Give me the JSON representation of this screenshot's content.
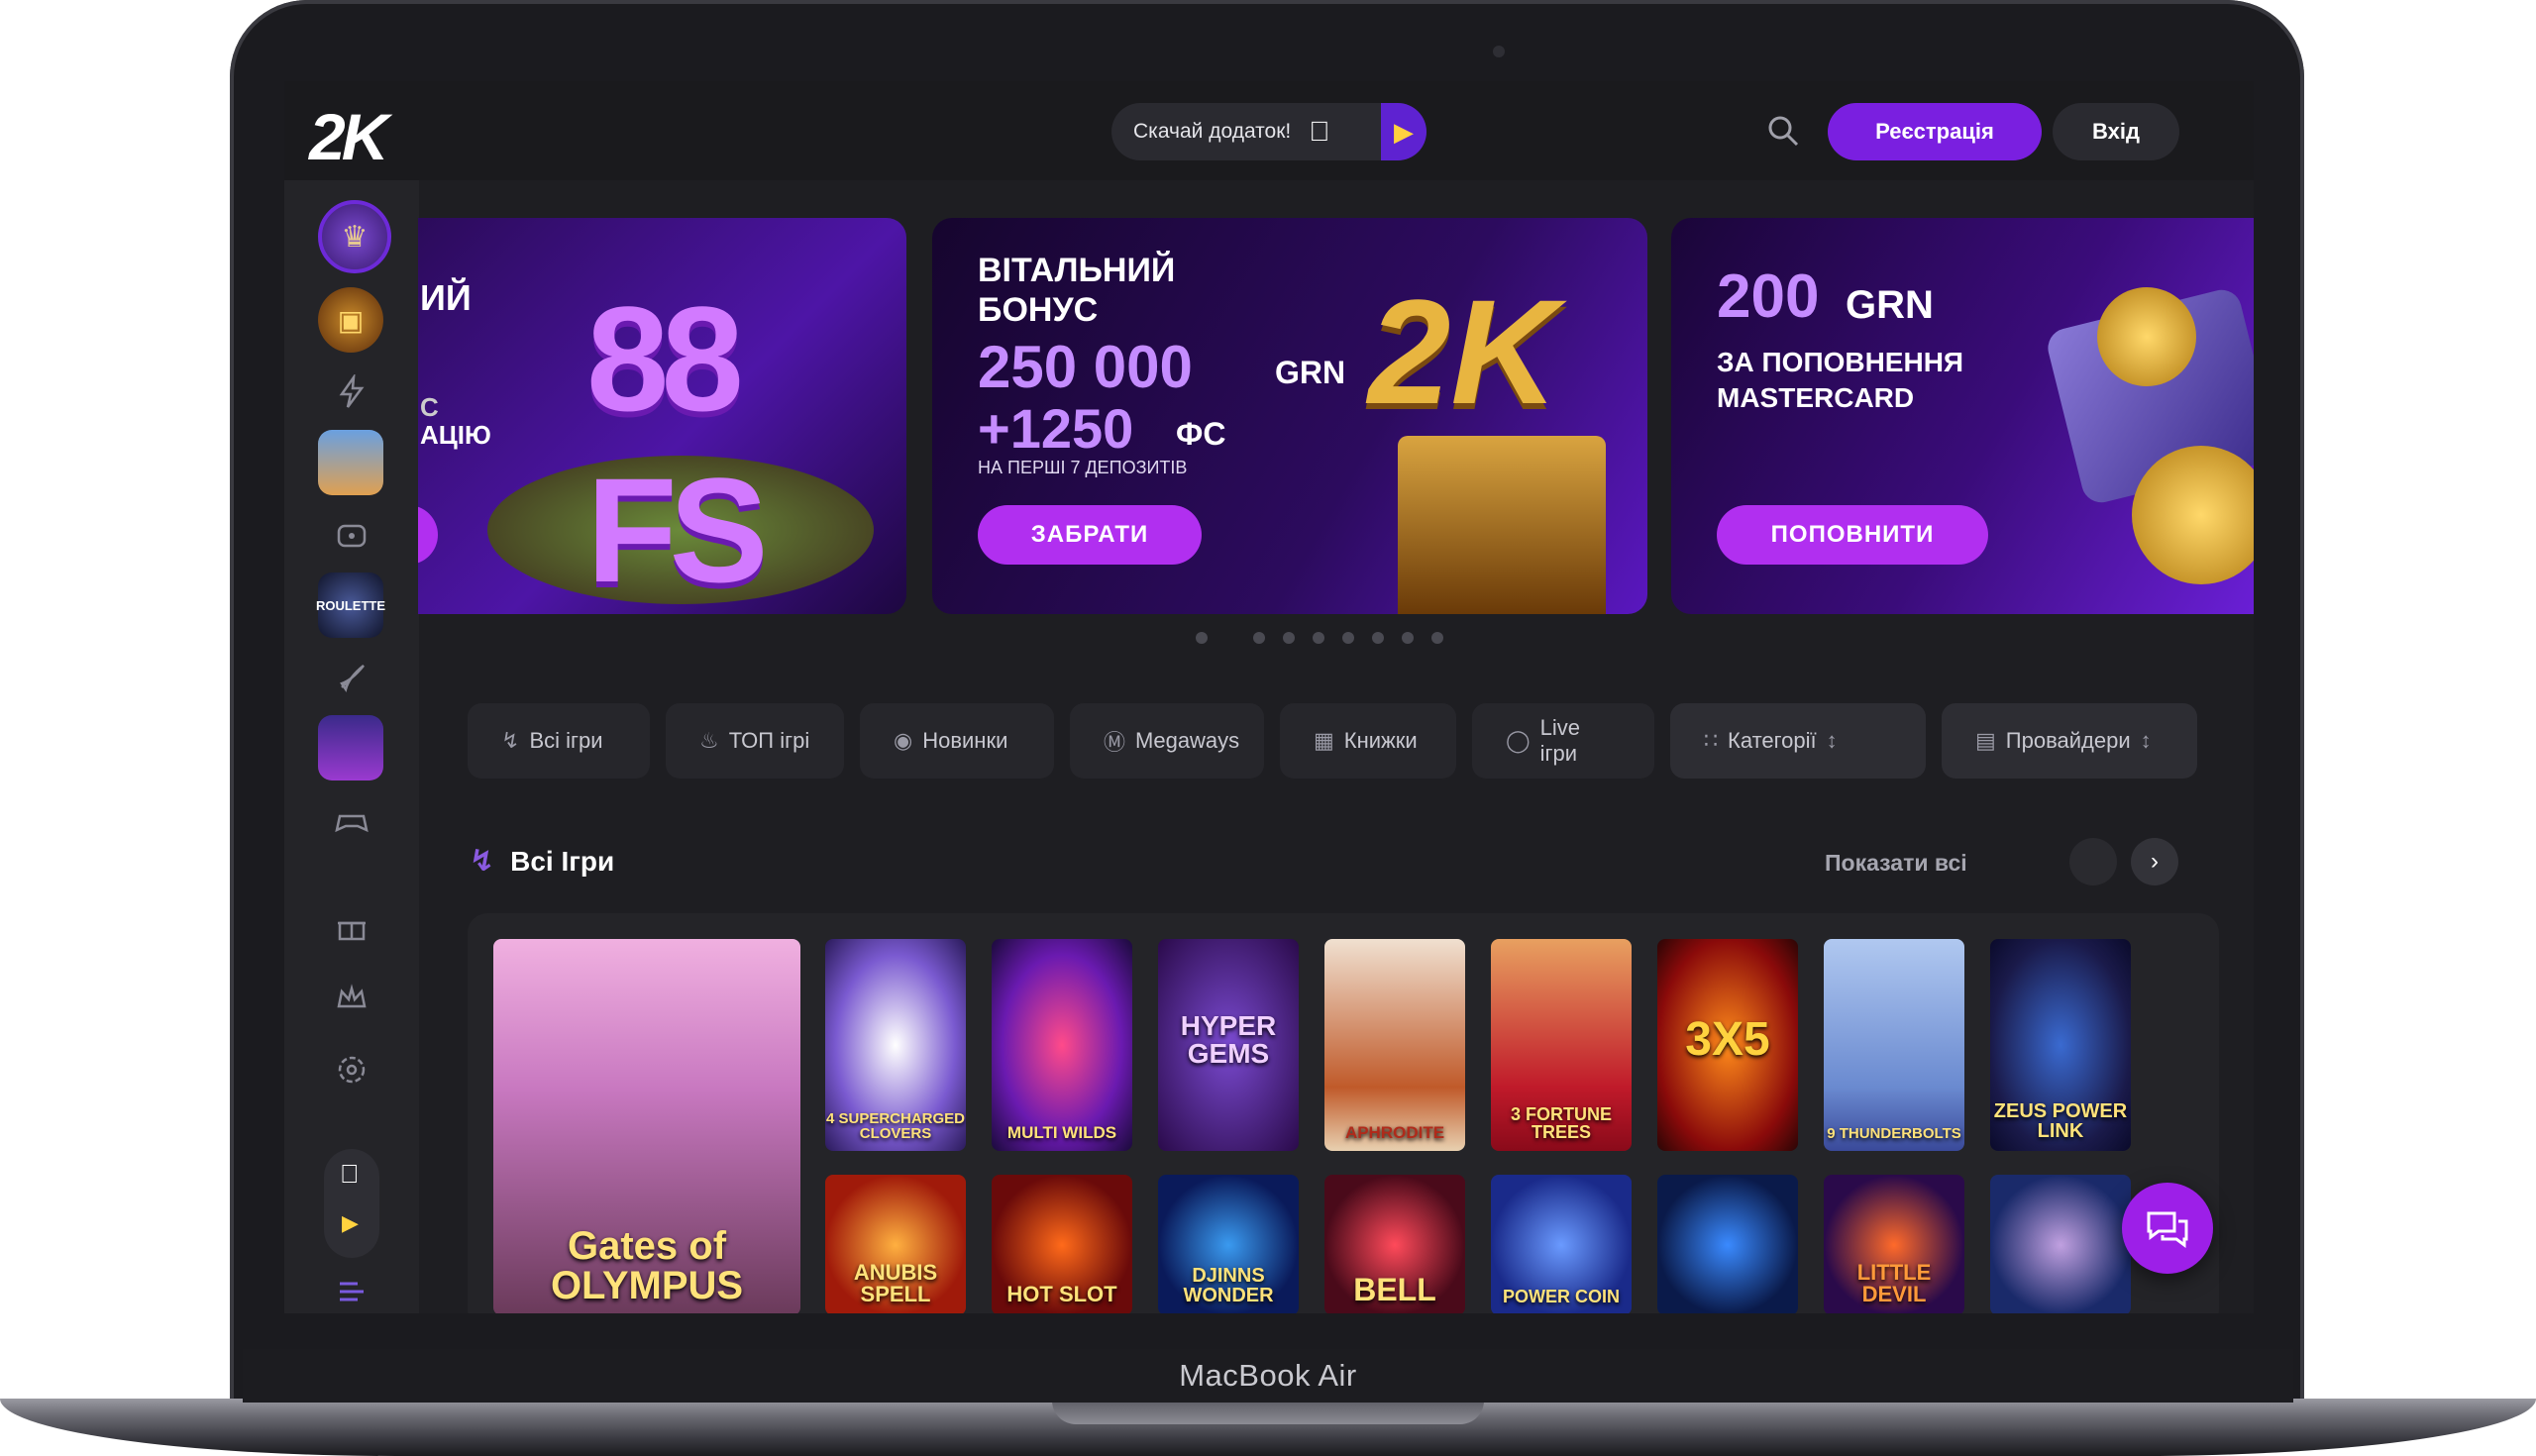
{
  "device": {
    "label": "MacBook Air"
  },
  "header": {
    "logo": "2K",
    "download_label": "Скачай додаток!",
    "register_label": "Реєстрація",
    "login_label": "Вхід"
  },
  "banners": [
    {
      "fragment_top": "ИЙ",
      "fragment_mid": "С",
      "fragment_bottom": "АЦІЮ",
      "badge": "88 FS"
    },
    {
      "line1": "ВІТАЛЬНИЙ",
      "line2": "БОНУС",
      "amount": "250 000",
      "currency": "GRN",
      "fs_amount": "+1250",
      "fs_unit": "ФС",
      "note": "НА ПЕРШІ 7 ДЕПОЗИТІВ",
      "button": "ЗАБРАТИ"
    },
    {
      "amount": "200",
      "currency": "GRN",
      "line1": "ЗА ПОПОВНЕННЯ",
      "line2": "MASTERCARD",
      "button": "ПОПОВНИТИ"
    }
  ],
  "filters": [
    {
      "label": "Всі ігри",
      "icon": "lightning-icon"
    },
    {
      "label": "ТОП ігрі",
      "icon": "flame-icon"
    },
    {
      "label": "Новинки",
      "icon": "new-icon"
    },
    {
      "label": "Megaways",
      "icon": "megaways-icon"
    },
    {
      "label": "Книжки",
      "icon": "book-icon"
    },
    {
      "label": "Live ігри",
      "icon": "live-icon"
    },
    {
      "label": "Категорії",
      "icon": "grid-icon"
    },
    {
      "label": "Провайдери",
      "icon": "provider-icon"
    }
  ],
  "section": {
    "title": "Всі Ігри",
    "show_all": "Показати всі"
  },
  "games": [
    {
      "title": "Gates of OLYMPUS"
    },
    {
      "title": "4 SUPERCHARGED CLOVERS"
    },
    {
      "title": "MULTI WILDS"
    },
    {
      "title": "HYPER GEMS"
    },
    {
      "title": "APHRODITE"
    },
    {
      "title": "3 FORTUNE TREES"
    },
    {
      "title": "3X5"
    },
    {
      "title": "9 THUNDERBOLTS"
    },
    {
      "title": "ZEUS POWER LINK"
    },
    {
      "title": "ANUBIS SPELL"
    },
    {
      "title": "HOT SLOT"
    },
    {
      "title": "DJINNS WONDER"
    },
    {
      "title": "BELL"
    },
    {
      "title": "POWER COIN"
    },
    {
      "title": ""
    },
    {
      "title": "LITTLE DEVIL"
    },
    {
      "title": ""
    }
  ],
  "colors": {
    "accent": "#7a1fe0",
    "pink": "#b12ff0",
    "bg": "#1e1e22"
  }
}
